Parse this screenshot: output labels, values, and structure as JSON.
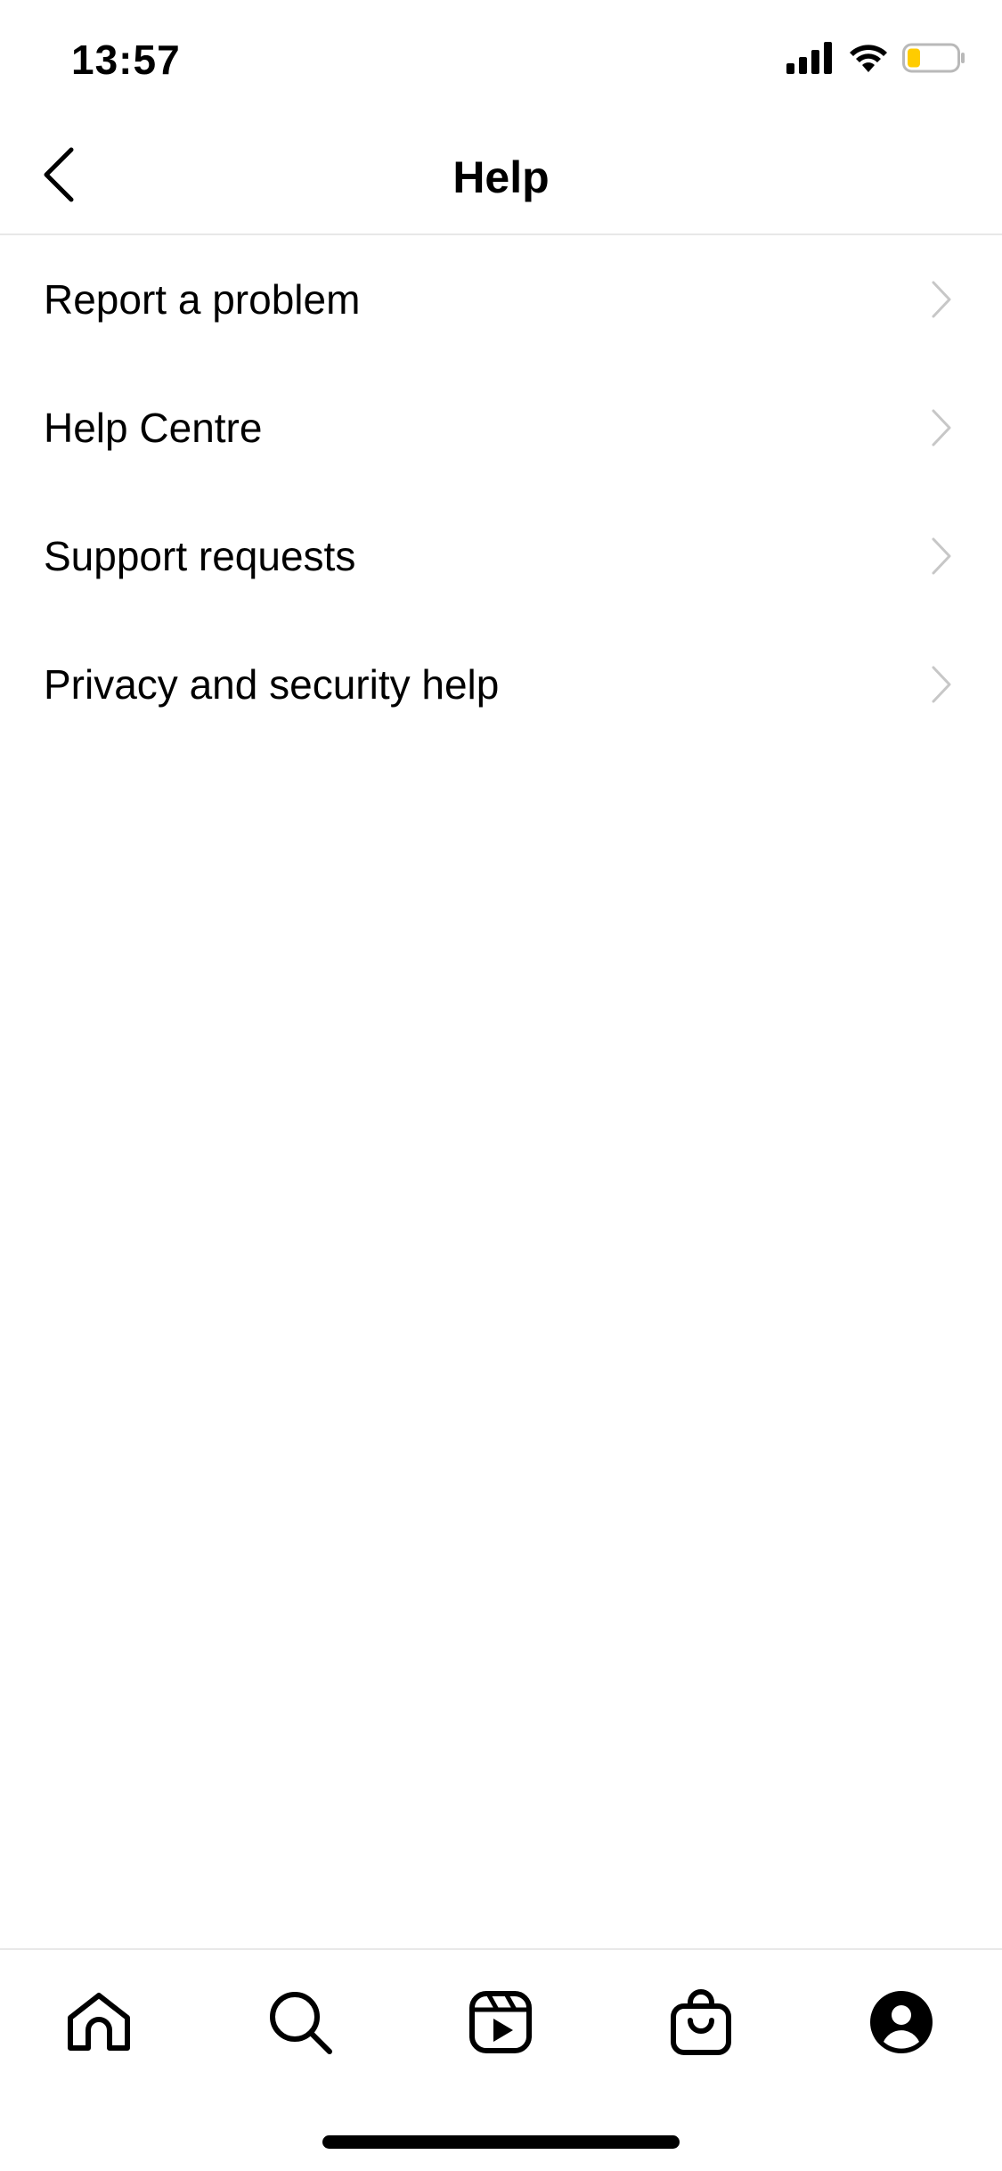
{
  "status_bar": {
    "time": "13:57",
    "icons": [
      "cellular-signal-icon",
      "wifi-icon",
      "battery-icon"
    ],
    "battery_fill_color": "#ffcc00"
  },
  "header": {
    "title": "Help",
    "back_icon": "chevron-left-icon"
  },
  "menu": {
    "items": [
      {
        "label": "Report a problem"
      },
      {
        "label": "Help Centre"
      },
      {
        "label": "Support requests"
      },
      {
        "label": "Privacy and security help"
      }
    ],
    "chevron_icon": "chevron-right-icon",
    "chevron_color": "#c7c7c7"
  },
  "tab_bar": {
    "tabs": [
      "home-icon",
      "search-icon",
      "reels-icon",
      "shop-icon",
      "profile-icon"
    ]
  },
  "colors": {
    "background": "#ffffff",
    "text": "#000000",
    "divider": "#e8e8e8"
  }
}
